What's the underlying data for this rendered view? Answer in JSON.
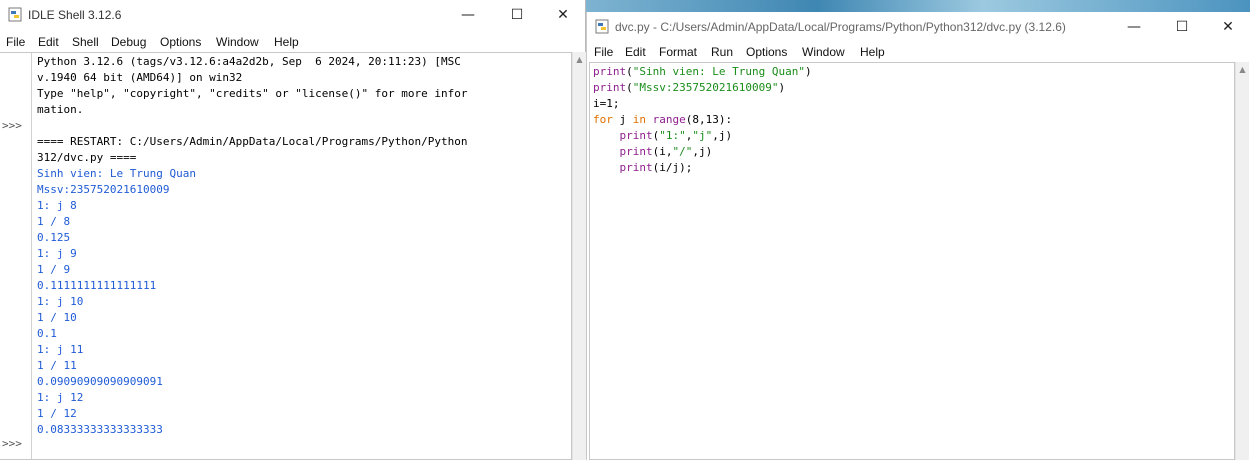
{
  "shell": {
    "title": "IDLE Shell 3.12.6",
    "controls": {
      "minimize": "—",
      "maximize": "☐",
      "close": "✕"
    },
    "menu": [
      "File",
      "Edit",
      "Shell",
      "Debug",
      "Options",
      "Window",
      "Help"
    ],
    "prompt": ">>>",
    "lines": [
      {
        "text": "Python 3.12.6 (tags/v3.12.6:a4a2d2b, Sep  6 2024, 20:11:23) [MSC",
        "kind": "std"
      },
      {
        "text": "v.1940 64 bit (AMD64)] on win32",
        "kind": "std"
      },
      {
        "text": "Type \"help\", \"copyright\", \"credits\" or \"license()\" for more infor",
        "kind": "std"
      },
      {
        "text": "mation.",
        "kind": "std"
      },
      {
        "text": "",
        "kind": "std"
      },
      {
        "text": "==== RESTART: C:/Users/Admin/AppData/Local/Programs/Python/Python",
        "kind": "std"
      },
      {
        "text": "312/dvc.py ====",
        "kind": "std"
      },
      {
        "text": "Sinh vien: Le Trung Quan",
        "kind": "out"
      },
      {
        "text": "Mssv:235752021610009",
        "kind": "out"
      },
      {
        "text": "1: j 8",
        "kind": "out"
      },
      {
        "text": "1 / 8",
        "kind": "out"
      },
      {
        "text": "0.125",
        "kind": "out"
      },
      {
        "text": "1: j 9",
        "kind": "out"
      },
      {
        "text": "1 / 9",
        "kind": "out"
      },
      {
        "text": "0.1111111111111111",
        "kind": "out"
      },
      {
        "text": "1: j 10",
        "kind": "out"
      },
      {
        "text": "1 / 10",
        "kind": "out"
      },
      {
        "text": "0.1",
        "kind": "out"
      },
      {
        "text": "1: j 11",
        "kind": "out"
      },
      {
        "text": "1 / 11",
        "kind": "out"
      },
      {
        "text": "0.09090909090909091",
        "kind": "out"
      },
      {
        "text": "1: j 12",
        "kind": "out"
      },
      {
        "text": "1 / 12",
        "kind": "out"
      },
      {
        "text": "0.08333333333333333",
        "kind": "out"
      }
    ]
  },
  "editor": {
    "title": "dvc.py - C:/Users/Admin/AppData/Local/Programs/Python/Python312/dvc.py (3.12.6)",
    "controls": {
      "minimize": "—",
      "maximize": "☐",
      "close": "✕"
    },
    "menu": [
      "File",
      "Edit",
      "Format",
      "Run",
      "Options",
      "Window",
      "Help"
    ],
    "code": [
      [
        {
          "t": "print",
          "c": "bi"
        },
        {
          "t": "(",
          "c": "plain"
        },
        {
          "t": "\"Sinh vien: Le Trung Quan\"",
          "c": "str"
        },
        {
          "t": ")",
          "c": "plain"
        }
      ],
      [
        {
          "t": "print",
          "c": "bi"
        },
        {
          "t": "(",
          "c": "plain"
        },
        {
          "t": "\"Mssv:235752021610009\"",
          "c": "str"
        },
        {
          "t": ")",
          "c": "plain"
        }
      ],
      [
        {
          "t": "i=1;",
          "c": "plain"
        }
      ],
      [
        {
          "t": "for",
          "c": "kw"
        },
        {
          "t": " j ",
          "c": "plain"
        },
        {
          "t": "in",
          "c": "kw"
        },
        {
          "t": " ",
          "c": "plain"
        },
        {
          "t": "range",
          "c": "bi"
        },
        {
          "t": "(8,13):",
          "c": "plain"
        }
      ],
      [
        {
          "t": "    ",
          "c": "plain"
        },
        {
          "t": "print",
          "c": "bi"
        },
        {
          "t": "(",
          "c": "plain"
        },
        {
          "t": "\"1:\"",
          "c": "str"
        },
        {
          "t": ",",
          "c": "plain"
        },
        {
          "t": "\"j\"",
          "c": "str"
        },
        {
          "t": ",j)",
          "c": "plain"
        }
      ],
      [
        {
          "t": "    ",
          "c": "plain"
        },
        {
          "t": "print",
          "c": "bi"
        },
        {
          "t": "(i,",
          "c": "plain"
        },
        {
          "t": "\"/\"",
          "c": "str"
        },
        {
          "t": ",j)",
          "c": "plain"
        }
      ],
      [
        {
          "t": "    ",
          "c": "plain"
        },
        {
          "t": "print",
          "c": "bi"
        },
        {
          "t": "(i/j);",
          "c": "plain"
        }
      ]
    ]
  }
}
